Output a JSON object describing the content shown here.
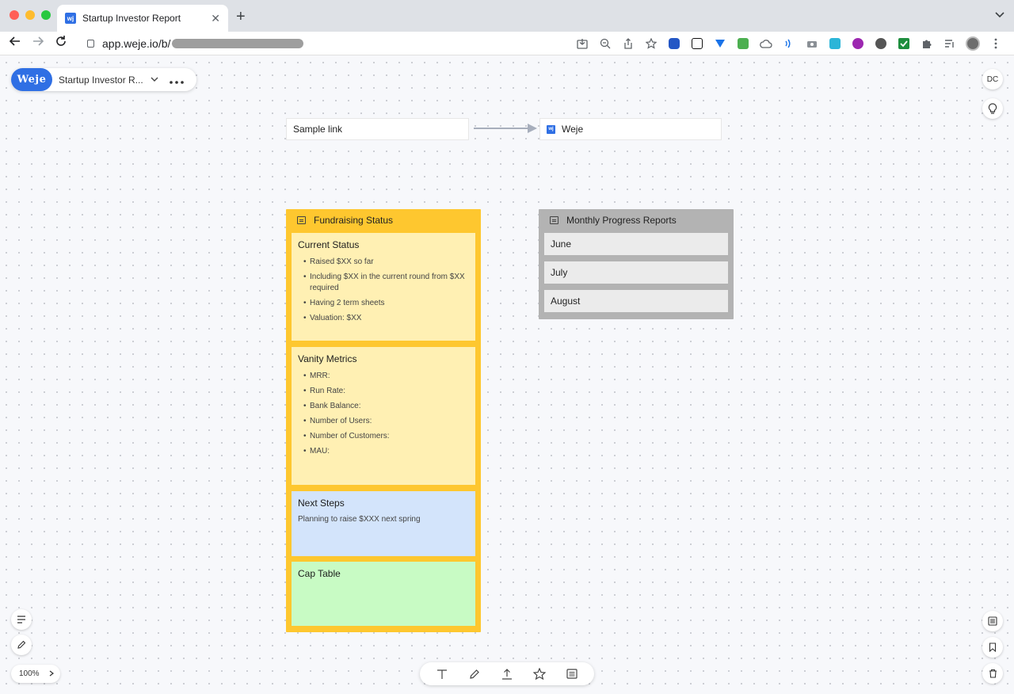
{
  "browser": {
    "tab_title": "Startup Investor Report",
    "tab_favicon": "wj",
    "tab_close": "✕",
    "new_tab": "+",
    "url": "app.weje.io/b/"
  },
  "app": {
    "logo": "Weje",
    "board_title": "Startup Investor R...",
    "user_initials": "DC",
    "zoom": "100%"
  },
  "links": {
    "source_label": "Sample link",
    "target_label": "Weje",
    "target_icon": "wj"
  },
  "fundraising": {
    "title": "Fundraising Status",
    "color": "#fec72f",
    "cards": {
      "current_status": {
        "title": "Current Status",
        "items": [
          "Raised $XX so far",
          "Including $XX in the current round from $XX required",
          "Having 2 term sheets",
          "Valuation: $XX"
        ]
      },
      "vanity_metrics": {
        "title": "Vanity Metrics",
        "items": [
          "MRR:",
          "Run Rate:",
          "Bank Balance:",
          "Number of Users:",
          "Number of Customers:",
          "MAU:"
        ]
      },
      "next_steps": {
        "title": "Next Steps",
        "text": "Planning to raise $XXX next spring"
      },
      "cap_table": {
        "title": "Cap Table"
      }
    }
  },
  "monthly": {
    "title": "Monthly Progress Reports",
    "items": [
      "June",
      "July",
      "August"
    ]
  },
  "colors": {
    "brand": "#2f6fe4",
    "yellow_card": "#fff0b3",
    "blue_card": "#d3e4fb",
    "green_card": "#c8fbc4",
    "gray_board": "#b3b3b3"
  }
}
